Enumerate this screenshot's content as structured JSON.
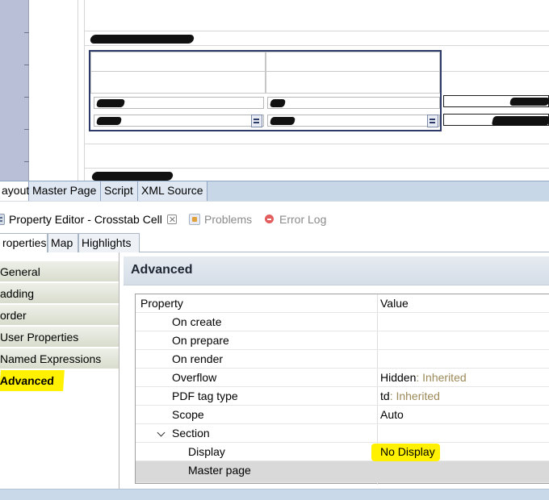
{
  "editor_tabs": [
    "ayout",
    "Master Page",
    "Script",
    "XML Source"
  ],
  "views": {
    "property_editor": "Property Editor - Crosstab Cell",
    "problems": "Problems",
    "error_log": "Error Log"
  },
  "sub_tabs": [
    "roperties",
    "Map",
    "Highlights"
  ],
  "categories": [
    "General",
    "adding",
    "order",
    "User Properties",
    "Named Expressions",
    "Advanced"
  ],
  "pane_title": "Advanced",
  "grid": {
    "col_property": "Property",
    "col_value": "Value",
    "rows": [
      {
        "name": "On create",
        "value": "",
        "inherited": ""
      },
      {
        "name": "On prepare",
        "value": "",
        "inherited": ""
      },
      {
        "name": "On render",
        "value": "",
        "inherited": ""
      },
      {
        "name": "Overflow",
        "value": "Hidden",
        "inherited": "Inherited"
      },
      {
        "name": "PDF tag type",
        "value": "td",
        "inherited": "Inherited"
      },
      {
        "name": "Scope",
        "value": "Auto",
        "inherited": ""
      },
      {
        "name": "Section",
        "value": "",
        "inherited": ""
      },
      {
        "name": "Display",
        "value": "No Display",
        "inherited": ""
      },
      {
        "name": "Master page",
        "value": "",
        "inherited": ""
      }
    ],
    "separator": ": "
  },
  "colors": {
    "highlight": "#fff100",
    "editor_tab_bar": "#c7d7e8",
    "inherited_text": "#9c8a58",
    "crosstab_border": "#2b3a67"
  }
}
